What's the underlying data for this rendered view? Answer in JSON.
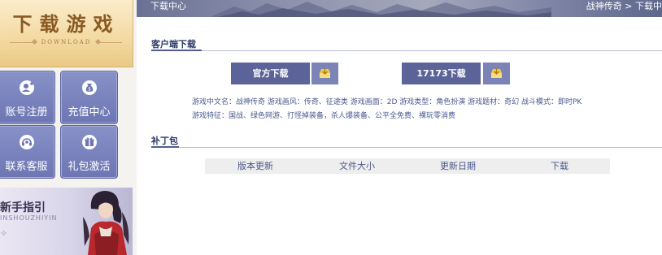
{
  "sidebar": {
    "download_banner": {
      "title": "下载游戏",
      "subtitle": "DOWNLOAD"
    },
    "buttons": [
      {
        "id": "register",
        "label": "账号注册",
        "icon": "user-plus-icon"
      },
      {
        "id": "recharge",
        "label": "充值中心",
        "icon": "money-bag-icon"
      },
      {
        "id": "service",
        "label": "联系客服",
        "icon": "headset-icon"
      },
      {
        "id": "gift",
        "label": "礼包激活",
        "icon": "gift-icon"
      }
    ],
    "guide": {
      "title": "新手指引",
      "pinyin": "INSHOUZHIYIN"
    }
  },
  "header": {
    "title": "下载中心",
    "breadcrumb": {
      "home": "战神传奇",
      "separator": " > ",
      "current": "下载中"
    }
  },
  "client_section": {
    "title": "客户端下载",
    "buttons": [
      {
        "label": "官方下载",
        "icon": "download-box-icon"
      },
      {
        "label": "17173下载",
        "icon": "download-box-icon"
      }
    ],
    "info_lines": [
      "游戏中文名：战神传奇 游戏画风：传奇、征途类 游戏画面：2D 游戏类型：角色扮演 游戏题材：奇幻 战斗模式：即时PK",
      "游戏特征：国战、绿色网游、打怪掉装备，杀人爆装备、公平全免费、裸玩零消费"
    ]
  },
  "patch_section": {
    "title": "补丁包",
    "columns": [
      "版本更新",
      "文件大小",
      "更新日期",
      "下载"
    ]
  },
  "colors": {
    "accent": "#5b6398",
    "accent_light": "#7c84b7",
    "sidebar_button": "#7880bb",
    "text_blue": "#4a5a8c",
    "title_blue": "#2c3b6a",
    "download_gold": "#f4dba5",
    "icon_gold": "#f2c94c"
  }
}
